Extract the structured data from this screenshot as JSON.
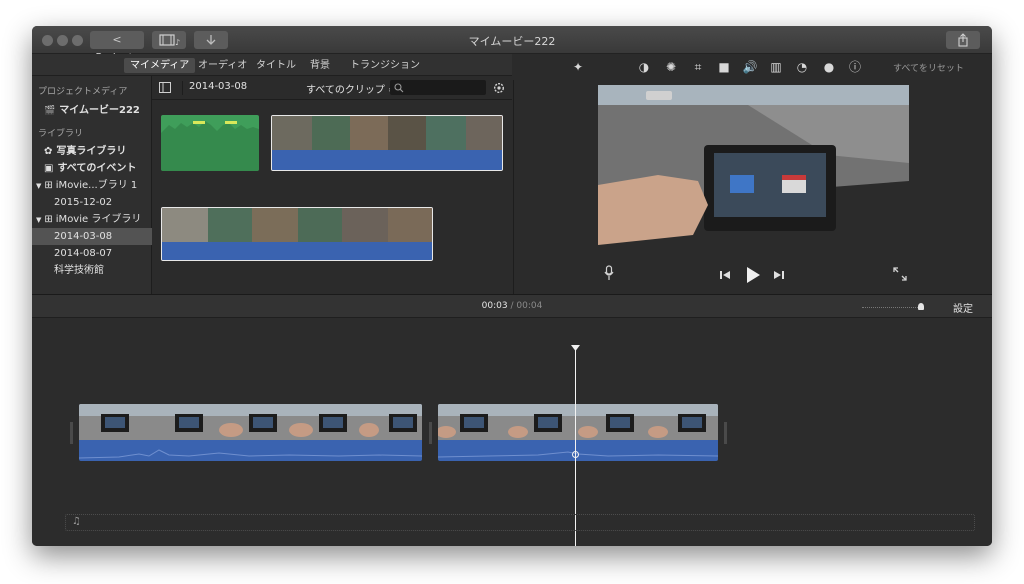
{
  "window": {
    "title": "マイムービー222",
    "projects_button": "< Projects"
  },
  "tabs": [
    "マイメディア",
    "オーディオ",
    "タイトル",
    "背景",
    "トランジション"
  ],
  "sidebar": {
    "project_media_header": "プロジェクトメディア",
    "project_item": "マイムービー222",
    "library_header": "ライブラリ",
    "items": [
      {
        "label": "写真ライブラリ"
      },
      {
        "label": "すべてのイベント"
      },
      {
        "label": "iMovie...ブラリ 1"
      },
      {
        "label": "2015-12-02"
      },
      {
        "label": "iMovie ライブラリ"
      },
      {
        "label": "2014-03-08"
      },
      {
        "label": "2014-08-07"
      },
      {
        "label": "科学技術館"
      }
    ]
  },
  "browser": {
    "event_date": "2014-03-08",
    "filter": "すべてのクリップ ≎"
  },
  "viewer": {
    "reset_label": "すべてをリセット",
    "icons": [
      "magic-wand-icon",
      "color-balance-icon",
      "palette-icon",
      "crop-icon",
      "stabilize-icon",
      "volume-icon",
      "equalizer-icon",
      "speed-icon",
      "filter-icon",
      "info-icon"
    ]
  },
  "timeline": {
    "current_time": "00:03",
    "separator": "/",
    "total_time": "00:04",
    "settings_label": "設定"
  },
  "colors": {
    "accent_blue": "#3a63b0",
    "green_clip": "#3f9e5a",
    "selection_red": "#e0463c"
  }
}
